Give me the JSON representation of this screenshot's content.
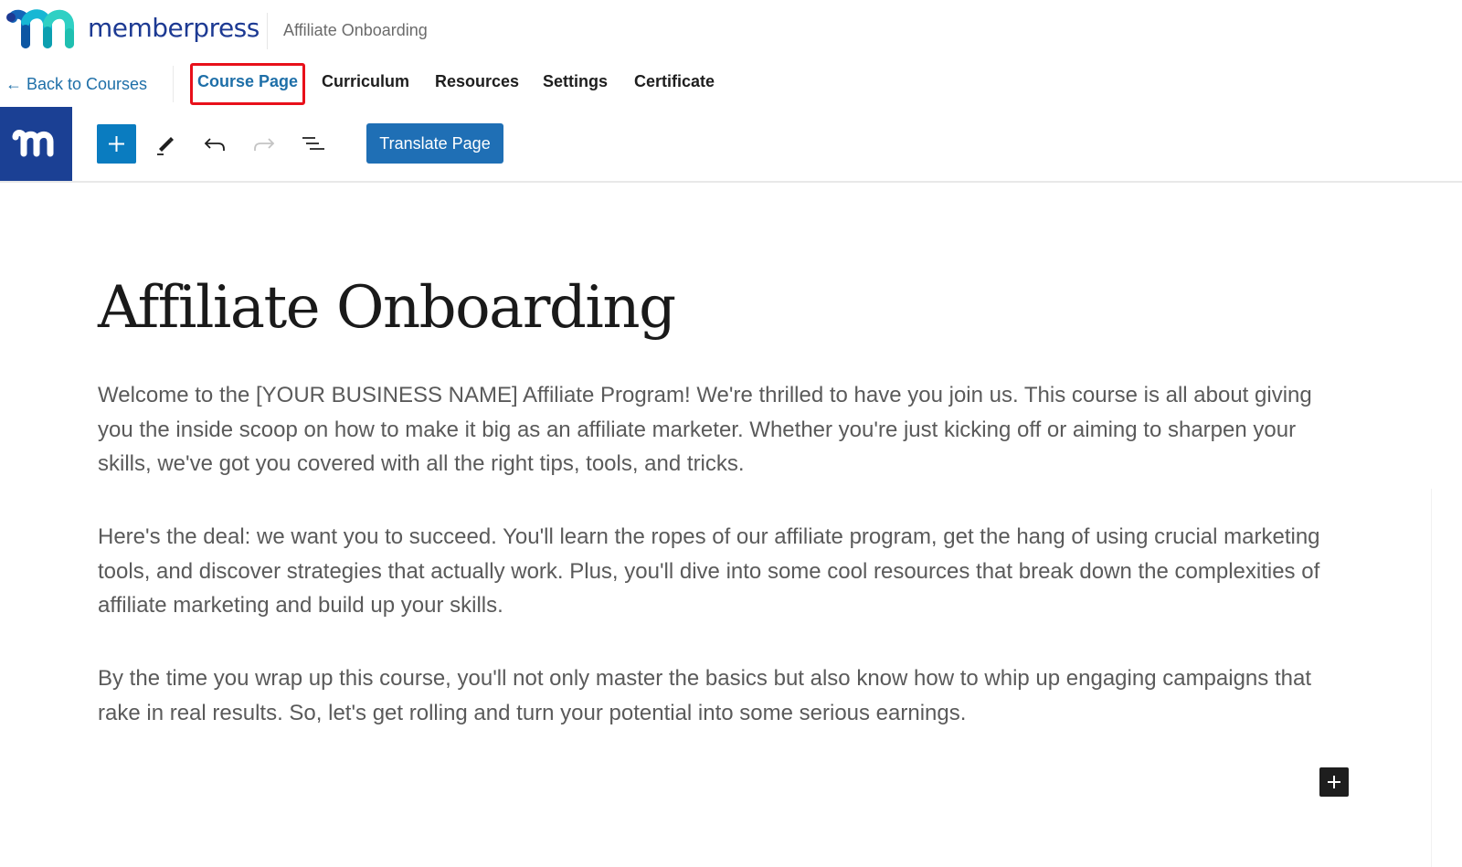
{
  "header": {
    "brand": "memberpress",
    "course_title": "Affiliate Onboarding"
  },
  "nav": {
    "back_label": "← Back to Courses",
    "tabs": [
      {
        "label": "Course Page",
        "active": true
      },
      {
        "label": "Curriculum",
        "active": false
      },
      {
        "label": "Resources",
        "active": false
      },
      {
        "label": "Settings",
        "active": false
      },
      {
        "label": "Certificate",
        "active": false
      }
    ],
    "highlight_color": "#e8101a"
  },
  "toolbar": {
    "icons": [
      "memberpress-logo-icon",
      "plus-icon",
      "pencil-icon",
      "undo-icon",
      "redo-icon",
      "list-view-icon"
    ],
    "redo_disabled": true,
    "translate_label": "Translate Page",
    "accent_color": "#0a7cc0",
    "brand_block_color": "#1b4094"
  },
  "content": {
    "title": "Affiliate Onboarding",
    "paragraphs": [
      "Welcome to the [YOUR BUSINESS NAME] Affiliate Program! We're thrilled to have you join us. This course is all about giving you the inside scoop on how to make it big as an affiliate marketer. Whether you're just kicking off or aiming to sharpen your skills, we've got you covered with all the right tips, tools, and tricks.",
      "Here's the deal: we want you to succeed. You'll learn the ropes of our affiliate program, get the hang of using crucial marketing tools, and discover strategies that actually work. Plus, you'll dive into some cool resources that break down the complexities of affiliate marketing and build up your skills.",
      "By the time you wrap up this course, you'll not only master the basics but also know how to whip up engaging campaigns that rake in real results. So, let's get rolling and turn your potential into some serious earnings."
    ]
  }
}
